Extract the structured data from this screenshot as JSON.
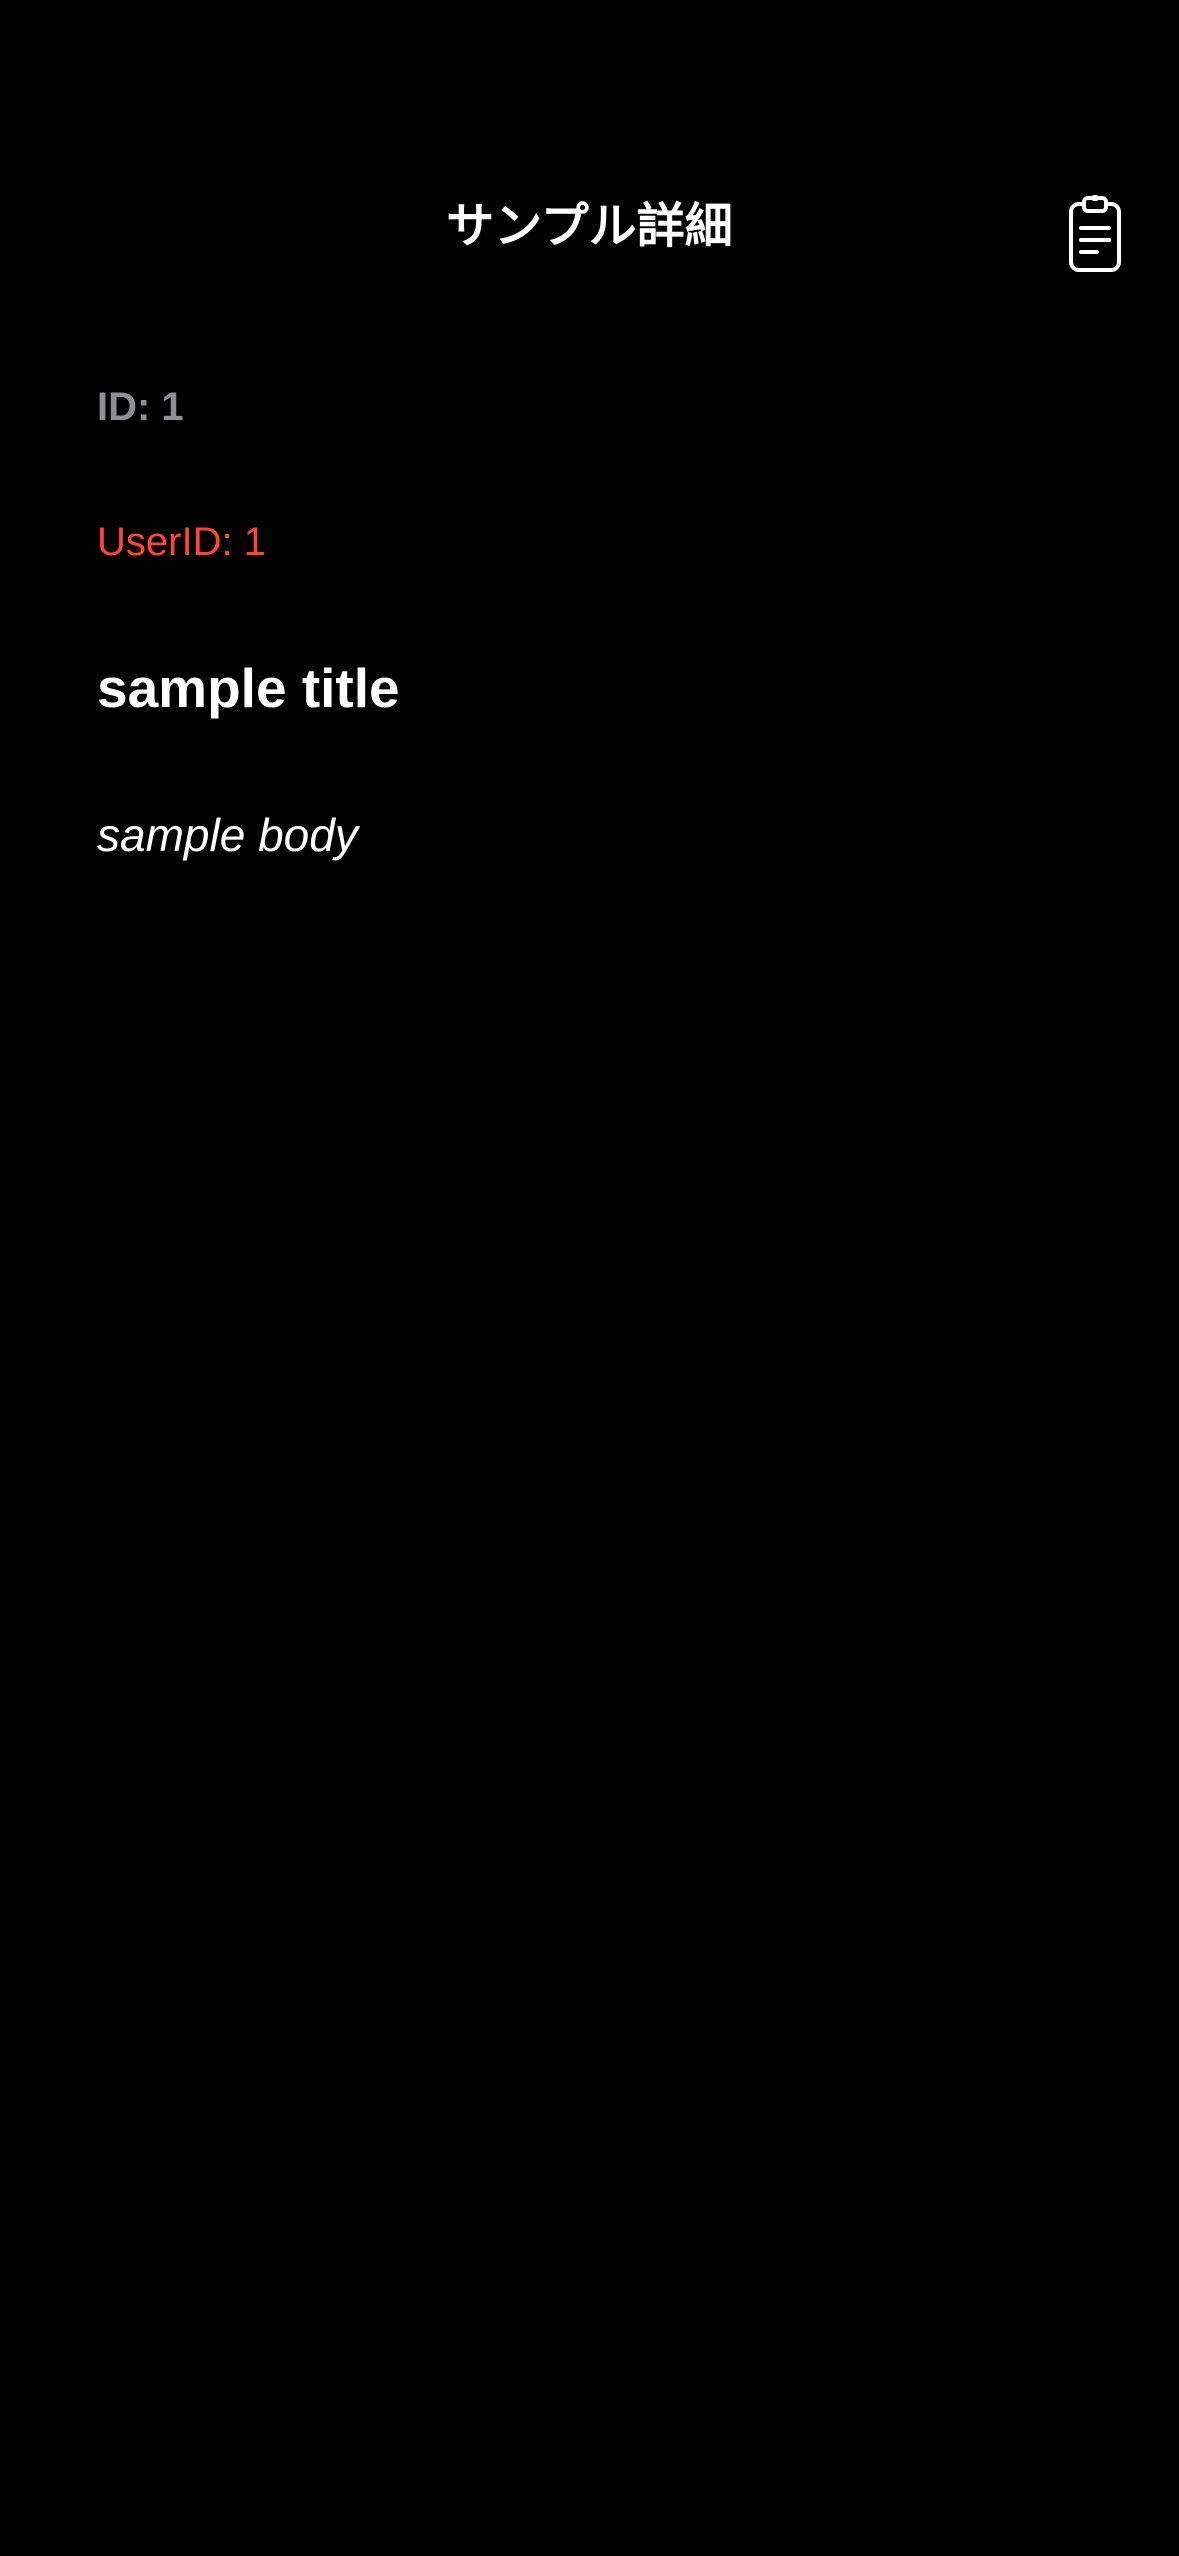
{
  "nav": {
    "title": "サンプル詳細",
    "copy_icon": "clipboard-icon"
  },
  "detail": {
    "id_text": "ID: 1",
    "user_id_text": "UserID: 1",
    "title": "sample title",
    "body": "sample body"
  },
  "colors": {
    "background": "#000000",
    "id_text": "#8e8e93",
    "user_id_text": "#ff453a",
    "primary_text": "#ffffff"
  }
}
